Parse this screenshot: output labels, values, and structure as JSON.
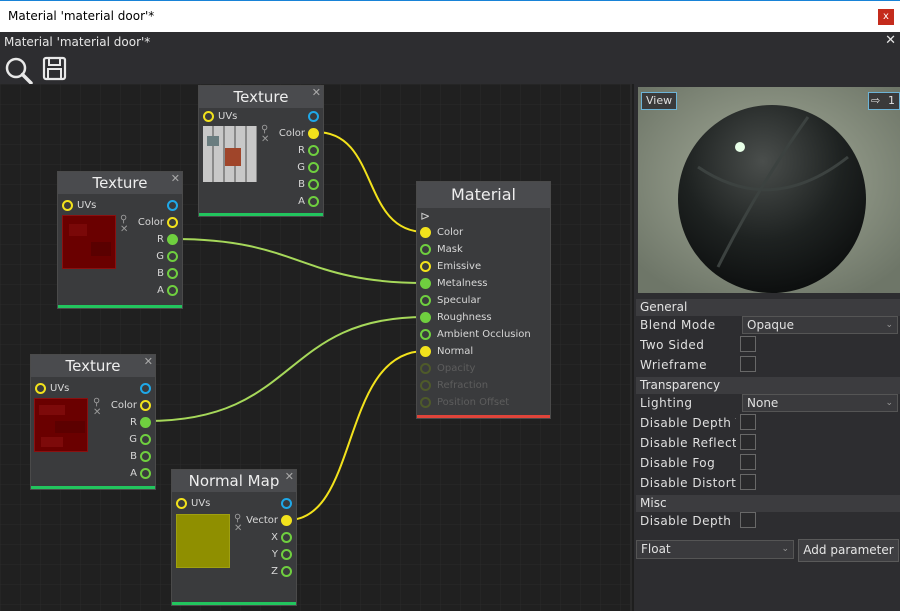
{
  "window": {
    "title": "Material 'material door'*",
    "close": "x"
  },
  "document": {
    "title": "Material 'material door'*",
    "close": "✕"
  },
  "toolbar": {
    "icons": [
      "search-icon",
      "save-icon"
    ]
  },
  "nodes": {
    "texture1": {
      "title": "Texture",
      "close": "✕",
      "uvs": "UVs",
      "color": "Color",
      "r": "R",
      "g": "G",
      "b": "B",
      "a": "A"
    },
    "texture2": {
      "title": "Texture",
      "close": "✕",
      "uvs": "UVs",
      "color": "Color",
      "r": "R",
      "g": "G",
      "b": "B",
      "a": "A"
    },
    "texture3": {
      "title": "Texture",
      "close": "✕",
      "uvs": "UVs",
      "color": "Color",
      "r": "R",
      "g": "G",
      "b": "B",
      "a": "A"
    },
    "normalmap": {
      "title": "Normal Map",
      "close": "✕",
      "uvs": "UVs",
      "vector": "Vector",
      "x": "X",
      "y": "Y",
      "z": "Z"
    },
    "material": {
      "title": "Material",
      "inputs": [
        "Color",
        "Mask",
        "Emissive",
        "Metalness",
        "Specular",
        "Roughness",
        "Ambient Occlusion",
        "Normal",
        "Opacity",
        "Refraction",
        "Position Offset"
      ]
    }
  },
  "preview": {
    "view_label": "View",
    "lod_label": "1"
  },
  "properties": {
    "general": {
      "title": "General",
      "blend_mode_label": "Blend Mode",
      "blend_mode_value": "Opaque",
      "two_sided_label": "Two Sided",
      "wireframe_label": "Wrieframe"
    },
    "transparency": {
      "title": "Transparency",
      "lighting_label": "Lighting",
      "lighting_value": "None",
      "disable_depth_test_label": "Disable Depth Test",
      "disable_reflections_label": "Disable Reflections",
      "disable_fog_label": "Disable Fog",
      "disable_distortion_label": "Disable Distortion"
    },
    "misc": {
      "title": "Misc",
      "disable_depth_write_label": "Disable Depth Write"
    },
    "param_type": "Float",
    "add_parameter": "Add parameter"
  },
  "colors": {
    "port_yellow": "#f2e21c",
    "port_blue": "#1fa8e8",
    "port_green": "#6fcf3f",
    "port_disabled": "#4e5a2a",
    "node_footer_green": "#22c55e",
    "material_footer_red": "#e0443a",
    "wire_yellow": "#f2e21c",
    "wire_green": "#a6d85a"
  }
}
